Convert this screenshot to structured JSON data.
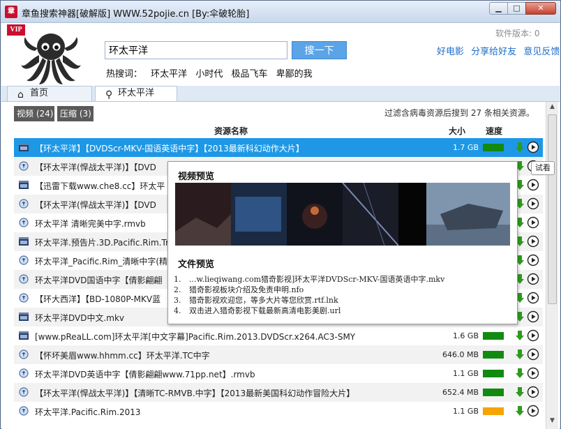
{
  "window": {
    "title": "章鱼搜索神器[破解版] WWW.52pojie.cn [By:伞破轮胎]",
    "app_icon": "章"
  },
  "header": {
    "vip": "VIP",
    "search_value": "环太平洋",
    "search_button": "搜一下",
    "hot_label": "热搜词：",
    "hot_words": [
      "环太平洋",
      "小时代",
      "极品飞车",
      "卑鄙的我"
    ],
    "version": "软件版本: 0",
    "links": [
      "好电影",
      "分享给好友",
      "意见反馈"
    ]
  },
  "tabs": [
    {
      "label": "首页",
      "icon": "home-icon"
    },
    {
      "label": "环太平洋",
      "icon": "search-icon"
    }
  ],
  "filters": {
    "video": "视频 (24)",
    "zip": "压缩 (3)",
    "info": "过滤含病毒资源后搜到 27 条相关资源。"
  },
  "columns": {
    "name": "资源名称",
    "size": "大小",
    "speed": "速度"
  },
  "colors": {
    "accent": "#1e98e6",
    "green": "#128a10",
    "orange": "#f5a400"
  },
  "rows": [
    {
      "name": "【环太平洋】【DVDScr-MKV-国语英语中字】【2013最新科幻动作大片】",
      "size": "1.7 GB",
      "type": "film",
      "speed": "green"
    },
    {
      "name": "【环太平洋(悍战太平洋)】【DVD",
      "size": "",
      "type": "emule",
      "speed": ""
    },
    {
      "name": "【迅雷下载www.che8.cc】环太平",
      "size": "",
      "type": "film",
      "speed": ""
    },
    {
      "name": "【环太平洋(悍战太平洋)】【DVD",
      "size": "",
      "type": "emule",
      "speed": ""
    },
    {
      "name": "环太平洋 清晰完美中字.rmvb",
      "size": "",
      "type": "emule",
      "speed": ""
    },
    {
      "name": "环太平洋.预告片.3D.Pacific.Rim.Tra",
      "size": "",
      "type": "film",
      "speed": ""
    },
    {
      "name": "环太平洋_Pacific.Rim_清晰中字(精",
      "size": "",
      "type": "emule",
      "speed": ""
    },
    {
      "name": "环太平洋DVD国语中字【倩影翩翩",
      "size": "",
      "type": "emule",
      "speed": ""
    },
    {
      "name": "【环大西洋】【BD-1080P-MKV蓝",
      "size": "",
      "type": "emule",
      "speed": ""
    },
    {
      "name": "环太平洋DVD中文.mkv",
      "size": "",
      "type": "film",
      "speed": ""
    },
    {
      "name": "[www.pReaLL.com]环太平洋[中文字幕]Pacific.Rim.2013.DVDScr.x264.AC3-SMY",
      "size": "1.6 GB",
      "type": "film",
      "speed": "green"
    },
    {
      "name": "【怀坏美眉www.hhmm.cc】环太平洋.TC中字",
      "size": "646.0 MB",
      "type": "emule",
      "speed": "green"
    },
    {
      "name": "环太平洋DVD英语中字【倩影翩翩www.71pp.net】.rmvb",
      "size": "1.1 GB",
      "type": "emule",
      "speed": "green"
    },
    {
      "name": "【环太平洋(悍战太平洋)】【清晰TC-RMVB.中字】【2013最新美国科幻动作冒险大片】",
      "size": "652.4 MB",
      "type": "emule",
      "speed": "green"
    },
    {
      "name": "环太平洋.Pacific.Rim.2013",
      "size": "1.1 GB",
      "type": "emule",
      "speed": "orange"
    }
  ],
  "preview": {
    "video_title": "视频预览",
    "file_title": "文件预览",
    "files": [
      {
        "num": "1.",
        "name": "...w.lieqiwang.com猎奇影视]环太平洋DVDScr-MKV-国语英语中字.mkv"
      },
      {
        "num": "2.",
        "name": "猎奇影视板块介绍及免责申明.nfo"
      },
      {
        "num": "3.",
        "name": "猎奇影视欢迎您，等多大片等您欣赏.rtf.lnk"
      },
      {
        "num": "4.",
        "name": "双击进入猎奇影视下载最新高清电影美剧.url"
      }
    ]
  },
  "tooltip": "试看"
}
